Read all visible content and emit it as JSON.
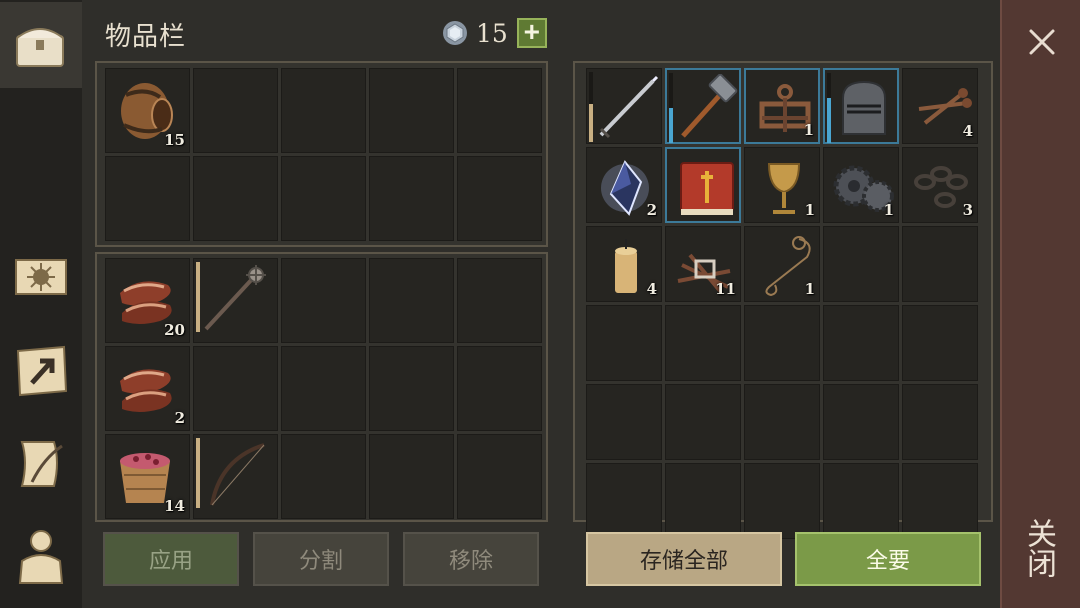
{
  "title": "物品栏",
  "currency": {
    "amount": "15",
    "icon": "silver-gem-icon",
    "plus_label": "+"
  },
  "nav": [
    {
      "name": "tab-inventory",
      "icon": "chest-icon",
      "active": true
    },
    {
      "name": "tab-skills",
      "icon": "sun-book-icon",
      "active": false
    },
    {
      "name": "tab-map",
      "icon": "map-arrow-icon",
      "active": false
    },
    {
      "name": "tab-quests",
      "icon": "scroll-quill-icon",
      "active": false
    },
    {
      "name": "tab-character",
      "icon": "character-icon",
      "active": false
    }
  ],
  "backpack": [
    [
      {
        "icon": "barrel-icon",
        "qty": "15"
      },
      null,
      null,
      null,
      null
    ],
    [
      null,
      null,
      null,
      null,
      null
    ]
  ],
  "hotbar": [
    [
      {
        "icon": "meat-icon",
        "qty": "20"
      },
      {
        "icon": "spiked-mace-icon",
        "qty": "",
        "durability": 1.0,
        "dur_color": "#c9b083"
      },
      null,
      null,
      null
    ],
    [
      {
        "icon": "meat-icon",
        "qty": "2"
      },
      null,
      null,
      null,
      null
    ],
    [
      {
        "icon": "berry-bucket-icon",
        "qty": "14"
      },
      {
        "icon": "bow-icon",
        "qty": "",
        "durability": 1.0,
        "dur_color": "#c9b083"
      },
      null,
      null,
      null
    ]
  ],
  "storage": [
    [
      {
        "icon": "sword-icon",
        "qty": "",
        "durability": 0.55,
        "dur_color": "#c9b083"
      },
      {
        "icon": "hammer-icon",
        "qty": "",
        "durability": 0.5,
        "dur_color": "#4aa6d1",
        "blue": true
      },
      {
        "icon": "iron-hinge-icon",
        "qty": "1",
        "blue": true
      },
      {
        "icon": "knight-helmet-icon",
        "qty": "",
        "durability": 0.65,
        "dur_color": "#4aa6d1",
        "blue": true
      },
      {
        "icon": "nails-icon",
        "qty": "4"
      }
    ],
    [
      {
        "icon": "crystal-icon",
        "qty": "2"
      },
      {
        "icon": "red-book-icon",
        "qty": "",
        "blue": true
      },
      {
        "icon": "goblet-icon",
        "qty": "1"
      },
      {
        "icon": "gears-icon",
        "qty": "1"
      },
      {
        "icon": "chain-icon",
        "qty": "3"
      }
    ],
    [
      {
        "icon": "candle-icon",
        "qty": "4"
      },
      {
        "icon": "scrap-pile-icon",
        "qty": "11"
      },
      {
        "icon": "rope-icon",
        "qty": "1"
      },
      null,
      null
    ],
    [
      null,
      null,
      null,
      null,
      null
    ],
    [
      null,
      null,
      null,
      null,
      null
    ],
    [
      null,
      null,
      null,
      null,
      null
    ]
  ],
  "buttons": {
    "apply": "应用",
    "split": "分割",
    "remove": "移除",
    "store_all": "存储全部",
    "take_all": "全要"
  },
  "close": {
    "label": "关闭",
    "icon": "close-x-icon"
  }
}
